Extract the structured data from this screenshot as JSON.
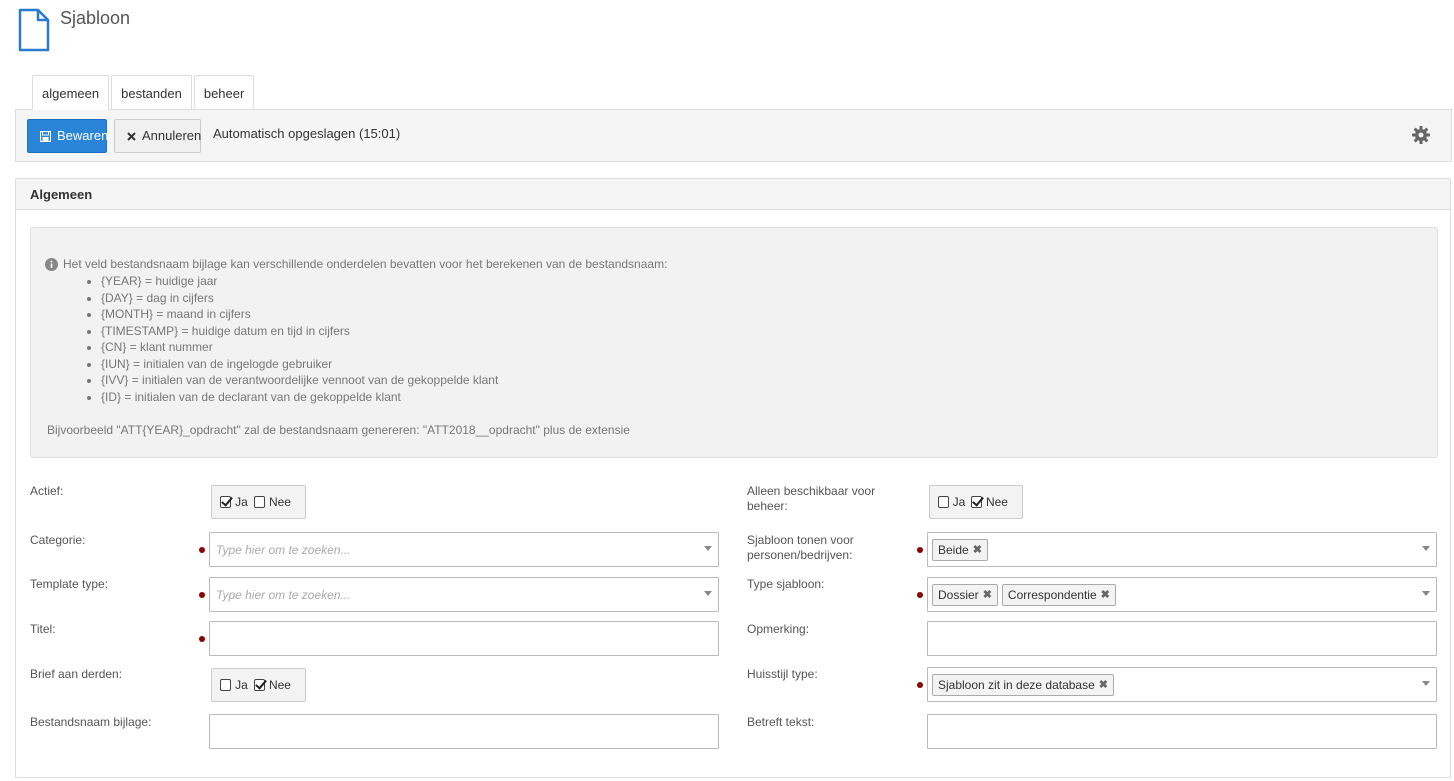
{
  "header": {
    "title": "Sjabloon",
    "icon": "document-icon"
  },
  "tabs": [
    {
      "label": "algemeen",
      "active": true
    },
    {
      "label": "bestanden",
      "active": false
    },
    {
      "label": "beheer",
      "active": false
    }
  ],
  "toolbar": {
    "save_label": "Bewaren",
    "cancel_label": "Annuleren",
    "autosave_text": "Automatisch opgeslagen (15:01)",
    "save_color": "#2a84d8"
  },
  "panel": {
    "title": "Algemeen",
    "info": {
      "intro": "Het veld bestandsnaam bijlage kan verschillende onderdelen bevatten voor het berekenen van de bestandsnaam:",
      "items": [
        "{YEAR} = huidige jaar",
        "{DAY} = dag in cijfers",
        "{MONTH} = maand in cijfers",
        "{TIMESTAMP} = huidige datum en tijd in cijfers",
        "{CN} = klant nummer",
        "{IUN} = initialen van de ingelogde gebruiker",
        "{IVV} = initialen van de verantwoordelijke vennoot van de gekoppelde klant",
        "{ID} = initialen van de declarant van de gekoppelde klant"
      ],
      "example": "Bijvoorbeeld \"ATT{YEAR}_opdracht\" zal de bestandsnaam genereren: \"ATT2018__opdracht\" plus de extensie"
    }
  },
  "form": {
    "actief": {
      "label": "Actief:",
      "yes": "Ja",
      "no": "Nee",
      "value": "Ja"
    },
    "categorie": {
      "label": "Categorie:",
      "placeholder": "Type hier om te zoeken..."
    },
    "template_type": {
      "label": "Template type:",
      "placeholder": "Type hier om te zoeken..."
    },
    "titel": {
      "label": "Titel:",
      "value": ""
    },
    "brief_aan_derden": {
      "label": "Brief aan derden:",
      "yes": "Ja",
      "no": "Nee",
      "value": "Nee"
    },
    "bestandsnaam_bijlage": {
      "label": "Bestandsnaam bijlage:",
      "value": ""
    },
    "alleen_beheer": {
      "label": "Alleen beschikbaar voor beheer:",
      "yes": "Ja",
      "no": "Nee",
      "value": "Nee"
    },
    "sjabloon_tonen": {
      "label": "Sjabloon tonen voor personen/bedrijven:",
      "tags": [
        "Beide"
      ]
    },
    "type_sjabloon": {
      "label": "Type sjabloon:",
      "tags": [
        "Dossier",
        "Correspondentie"
      ]
    },
    "opmerking": {
      "label": "Opmerking:",
      "value": ""
    },
    "huisstijl_type": {
      "label": "Huisstijl type:",
      "tags": [
        "Sjabloon zit in deze database"
      ]
    },
    "betreft_tekst": {
      "label": "Betreft tekst:",
      "value": ""
    }
  }
}
